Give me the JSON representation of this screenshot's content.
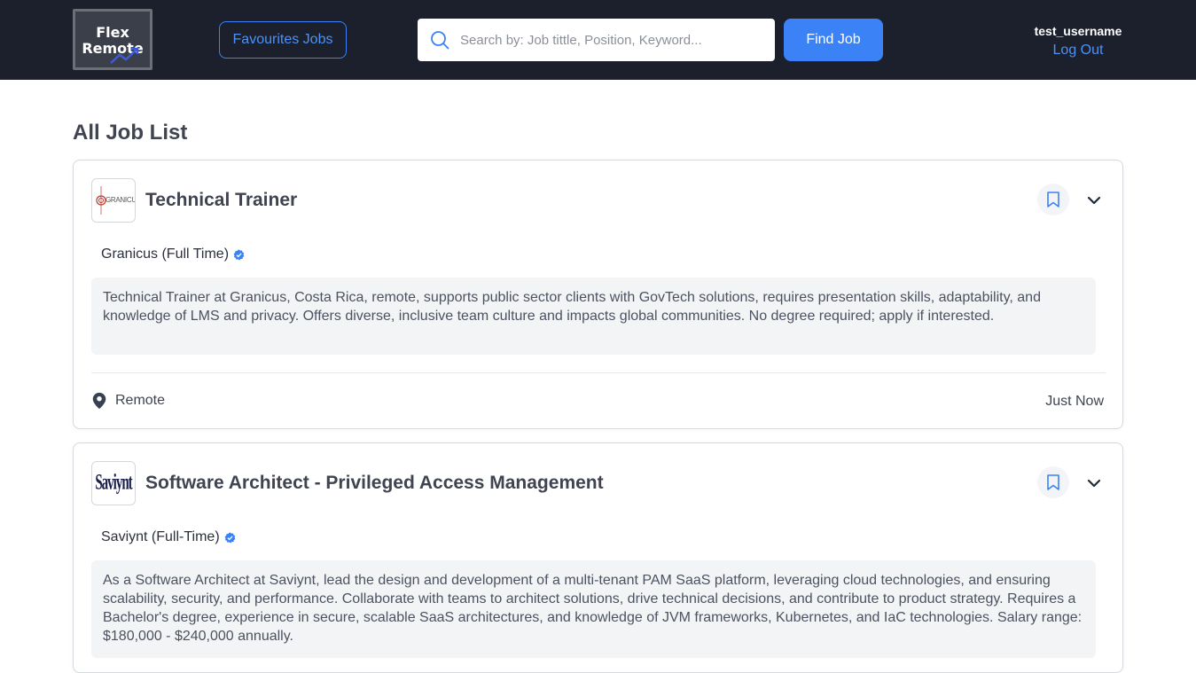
{
  "header": {
    "logo_line1": "Flex",
    "logo_line2": "Remote",
    "favourites_label": "Favourites Jobs",
    "search_placeholder": "Search by: Job tittle, Position, Keyword...",
    "find_label": "Find Job",
    "username": "test_username",
    "logout_label": "Log Out"
  },
  "colors": {
    "header_bg": "#1b202c",
    "accent": "#3b82f6",
    "verified": "#3b82f6"
  },
  "main": {
    "title": "All Job List",
    "jobs": [
      {
        "title": "Technical Trainer",
        "company": "Granicus (Full Time)",
        "logo_text": "GRANICUS",
        "description": "Technical Trainer at Granicus, Costa Rica, remote, supports public sector clients with GovTech solutions, requires presentation skills, adaptability, and knowledge of LMS and privacy. Offers diverse, inclusive team culture and impacts global communities. No degree required; apply if interested.",
        "location": "Remote",
        "posted": "Just Now",
        "icons": [
          "bookmark-icon",
          "chevron-down-icon",
          "verified-icon",
          "map-pin-icon"
        ]
      },
      {
        "title": "Software Architect - Privileged Access Management",
        "company": "Saviynt (Full-Time)",
        "logo_text": "Saviynt",
        "description": "As a Software Architect at Saviynt, lead the design and development of a multi-tenant PAM SaaS platform, leveraging cloud technologies, and ensuring scalability, security, and performance. Collaborate with teams to architect solutions, drive technical decisions, and contribute to product strategy. Requires a Bachelor's degree, experience in secure, scalable SaaS architectures, and knowledge of JVM frameworks, Kubernetes, and IaC technologies. Salary range: $180,000 - $240,000 annually.",
        "icons": [
          "bookmark-icon",
          "chevron-down-icon",
          "verified-icon"
        ]
      }
    ]
  }
}
